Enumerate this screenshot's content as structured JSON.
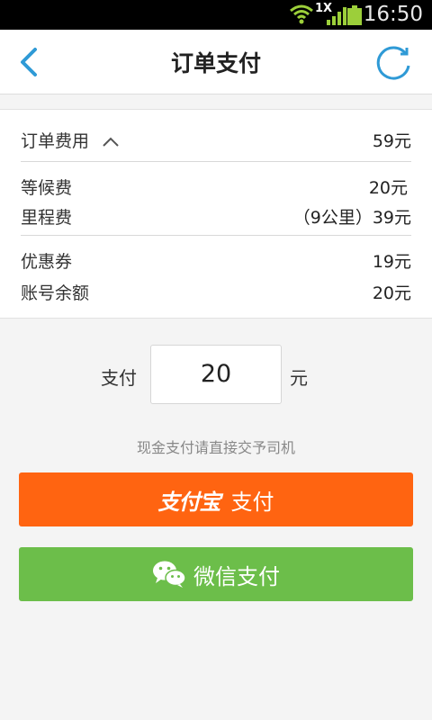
{
  "status_bar": {
    "time": "16:50",
    "network": "1X",
    "icons": [
      "wifi-icon",
      "signal-icon",
      "battery-icon"
    ]
  },
  "header": {
    "title": "订单支付",
    "back_icon": "chevron-left-icon",
    "refresh_icon": "refresh-icon"
  },
  "order": {
    "fee_label": "订单费用",
    "fee_value": "59元",
    "items": [
      {
        "label": "等候费",
        "value": "20元"
      },
      {
        "label": "里程费",
        "value": "（9公里）39元"
      }
    ],
    "discounts": [
      {
        "label": "优惠券",
        "value": "19元"
      },
      {
        "label": "账号余额",
        "value": "20元"
      }
    ]
  },
  "payment": {
    "label": "支付",
    "amount": "20",
    "unit": "元",
    "cash_note": "现金支付请直接交予司机"
  },
  "buttons": {
    "alipay_logo": "支付宝",
    "alipay_label": "支付",
    "wechat_label": "微信支付"
  },
  "colors": {
    "accent": "#2f9ad6",
    "alipay": "#ff6411",
    "wechat": "#6cbe4a"
  }
}
